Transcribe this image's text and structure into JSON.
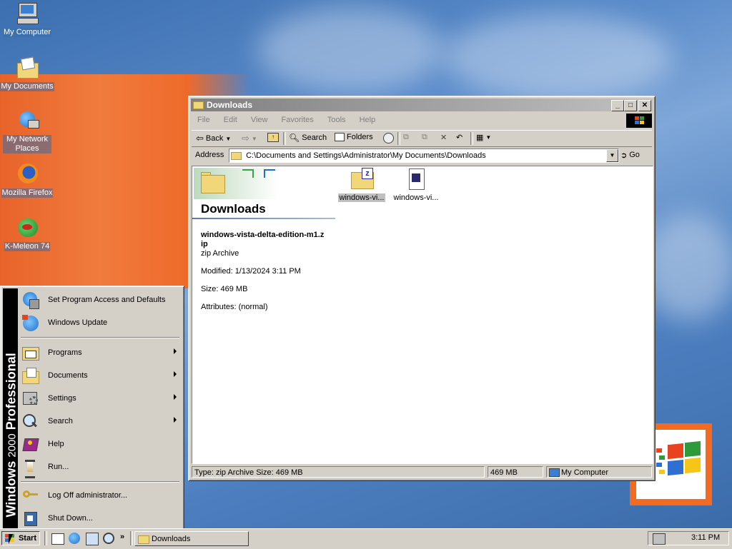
{
  "desktop": {
    "icons": [
      {
        "label": "My Computer"
      },
      {
        "label": "My Documents"
      },
      {
        "label": "My Network Places"
      },
      {
        "label": "Mozilla Firefox"
      },
      {
        "label": "K-Meleon 74"
      }
    ]
  },
  "window": {
    "title": "Downloads",
    "menu": [
      "File",
      "Edit",
      "View",
      "Favorites",
      "Tools",
      "Help"
    ],
    "toolbar": {
      "back": "Back",
      "search": "Search",
      "folders": "Folders"
    },
    "address": {
      "label": "Address",
      "value": "C:\\Documents and Settings\\Administrator\\My Documents\\Downloads",
      "go": "Go"
    },
    "panel": {
      "folder_title": "Downloads",
      "file_name": "windows-vista-delta-edition-m1.zip",
      "file_type": "zip Archive",
      "modified": "Modified: 1/13/2024 3:11 PM",
      "size": "Size: 469 MB",
      "attributes": "Attributes: (normal)"
    },
    "files": [
      {
        "label": "windows-vi..."
      },
      {
        "label": "windows-vi..."
      }
    ],
    "status": {
      "info": "Type: zip Archive Size: 469 MB",
      "size": "469 MB",
      "zone": "My Computer"
    }
  },
  "start_menu": {
    "band_brand": "Windows",
    "band_version": "2000",
    "band_edition": "Professional",
    "items": [
      {
        "label": "Set Program Access and Defaults"
      },
      {
        "label": "Windows Update"
      },
      {
        "label": "Programs"
      },
      {
        "label": "Documents"
      },
      {
        "label": "Settings"
      },
      {
        "label": "Search"
      },
      {
        "label": "Help"
      },
      {
        "label": "Run..."
      },
      {
        "label": "Log Off administrator..."
      },
      {
        "label": "Shut Down..."
      }
    ]
  },
  "taskbar": {
    "start_label": "Start",
    "task_label": "Downloads",
    "clock": "3:11 PM"
  },
  "colors": {
    "accent_orange": "#f26b21",
    "desktop_blue": "#3a6aa8"
  }
}
